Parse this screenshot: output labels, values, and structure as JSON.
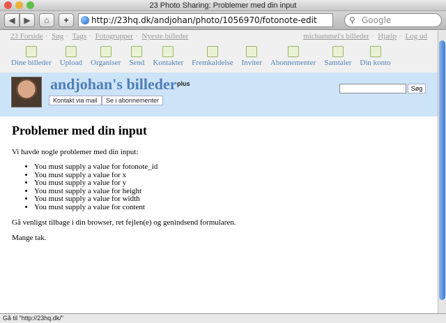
{
  "window": {
    "title": "23 Photo Sharing: Problemer med din input"
  },
  "toolbar": {
    "back_label": "◀",
    "forward_label": "▶",
    "home_label": "⌂",
    "add_label": "+",
    "url": "http://23hq.dk/andjohan/photo/1056970/fotonote-edit",
    "search_placeholder": "Google"
  },
  "topnav": {
    "left": [
      "23 Forside",
      "Søg",
      "Tags",
      "Fotogrupper",
      "Nyeste billeder"
    ],
    "right": [
      "michammel's billeder",
      "Hjælp",
      "Log ud"
    ]
  },
  "iconbar": [
    {
      "label": "Dine billeder",
      "icon": "photos-icon"
    },
    {
      "label": "Upload",
      "icon": "upload-icon"
    },
    {
      "label": "Organiser",
      "icon": "organize-icon"
    },
    {
      "label": "Send",
      "icon": "send-icon"
    },
    {
      "label": "Kontakter",
      "icon": "contacts-icon"
    },
    {
      "label": "Fremkaldelse",
      "icon": "print-icon"
    },
    {
      "label": "Inviter",
      "icon": "invite-icon"
    },
    {
      "label": "Abonnementer",
      "icon": "subscriptions-icon"
    },
    {
      "label": "Samtaler",
      "icon": "conversations-icon"
    },
    {
      "label": "Din konto",
      "icon": "account-icon"
    }
  ],
  "user": {
    "name": "andjohan's billeder",
    "badge": "plus",
    "contact_button": "Kontakt via mail",
    "subscribe_button": "Se i abonnementer",
    "search_button": "Søg"
  },
  "content": {
    "heading": "Problemer med din input",
    "intro": "Vi havde nogle problemer med din input:",
    "errors": [
      "You must supply a value for fotonote_id",
      "You must supply a value for x",
      "You must supply a value for y",
      "You must supply a value for height",
      "You must supply a value for width",
      "You must supply a value for content"
    ],
    "instruction": "Gå venligst tilbage i din browser, ret fejlen(e) og genindsend formularen.",
    "thanks": "Mange tak."
  },
  "status": {
    "text": "Gå til \"http://23hq.dk/\""
  },
  "colors": {
    "link": "#4f7fb7",
    "userbar_bg": "#cde3f7"
  }
}
